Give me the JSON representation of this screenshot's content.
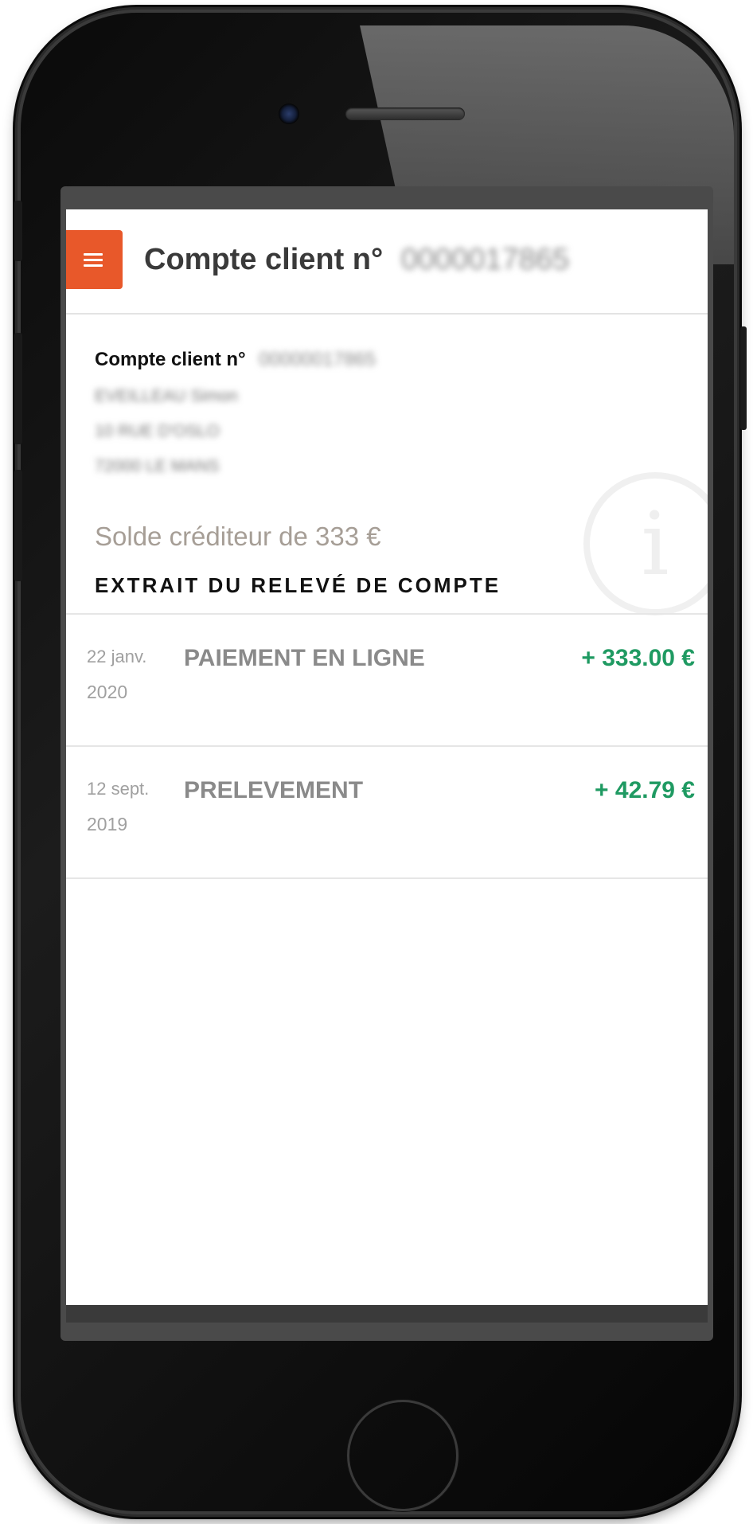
{
  "header": {
    "menu_icon": "hamburger-menu-icon",
    "title": "Compte client n°",
    "account_number_masked": "0000017865"
  },
  "account": {
    "label": "Compte client n°",
    "number_masked": "00000017865",
    "holder_masked": "EVEILLEAU Simon",
    "address_line1_masked": "10 RUE D'OSLO",
    "address_line2_masked": "72000 LE MANS",
    "balance_text": "Solde créditeur de 333 €",
    "info_icon": "info-icon"
  },
  "statement": {
    "title": "EXTRAIT DU RELEVÉ DE COMPTE",
    "transactions": [
      {
        "day_month": "22 janv.",
        "year": "2020",
        "label": "PAIEMENT EN LIGNE",
        "amount": "+ 333.00 €"
      },
      {
        "day_month": "12 sept.",
        "year": "2019",
        "label": "PRELEVEMENT",
        "amount": "+ 42.79 €"
      }
    ]
  },
  "colors": {
    "accent": "#e8582a",
    "positive_amount": "#1f9a62",
    "balance": "#a69e96"
  }
}
